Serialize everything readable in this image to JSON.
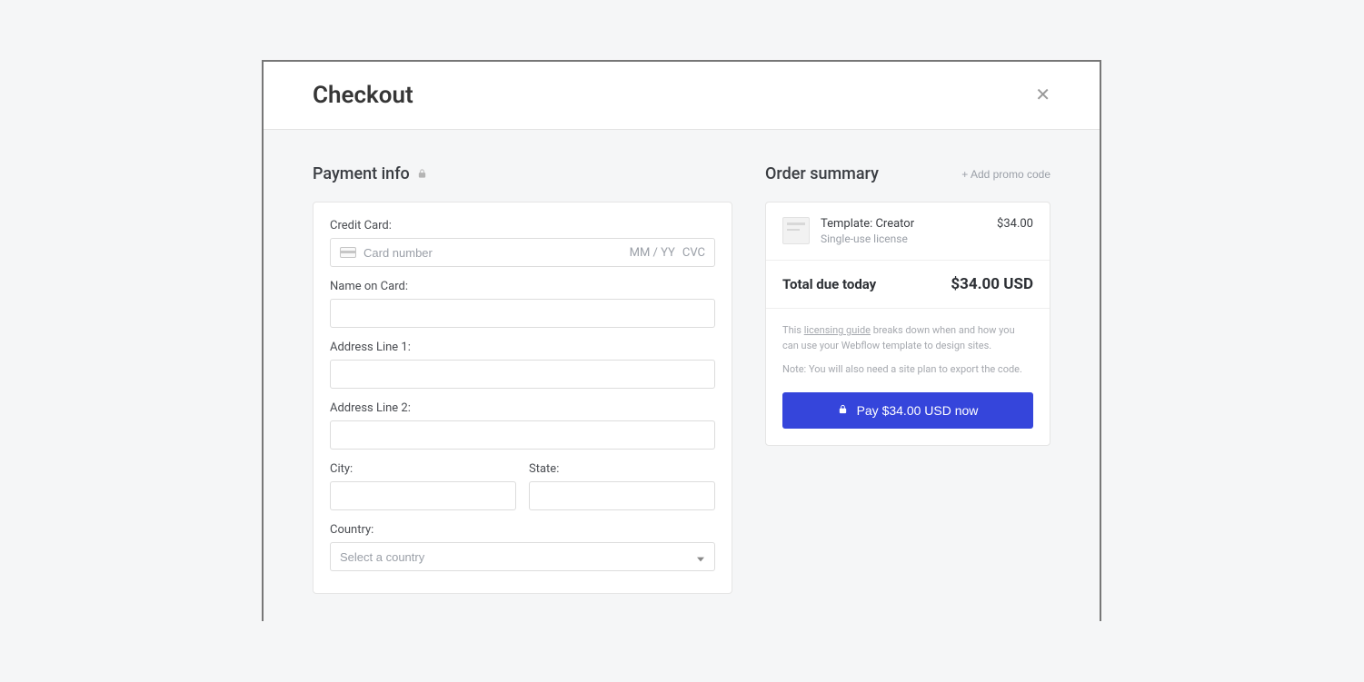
{
  "header": {
    "title": "Checkout"
  },
  "payment": {
    "section_title": "Payment info",
    "credit_card_label": "Credit Card:",
    "card_number_placeholder": "Card number",
    "card_exp_placeholder": "MM / YY",
    "card_cvc_placeholder": "CVC",
    "name_label": "Name on Card:",
    "address1_label": "Address Line 1:",
    "address2_label": "Address Line 2:",
    "city_label": "City:",
    "state_label": "State:",
    "country_label": "Country:",
    "country_placeholder": "Select a country"
  },
  "summary": {
    "section_title": "Order summary",
    "promo_link": "+ Add promo code",
    "item_title": "Template: Creator",
    "item_subtitle": "Single-use license",
    "item_price": "$34.00",
    "total_label": "Total due today",
    "total_value": "$34.00 USD",
    "note_prefix": "This ",
    "note_link": "licensing guide",
    "note_suffix": " breaks down when and how you can use your Webflow template to design sites.",
    "note2": "Note: You will also need a site plan to export the code.",
    "pay_label": "Pay $34.00 USD now"
  }
}
